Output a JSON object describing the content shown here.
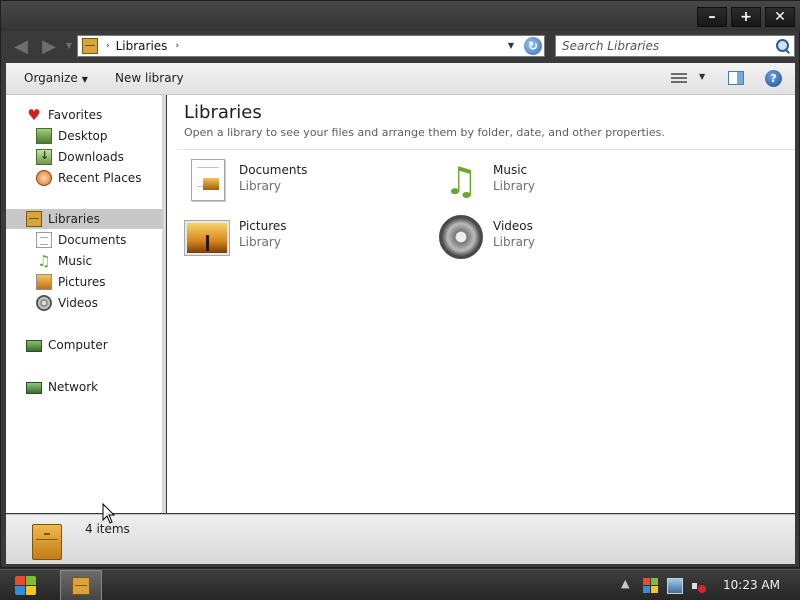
{
  "window": {
    "caption_buttons": {
      "minimize": "–",
      "maximize": "+",
      "close": "✕"
    }
  },
  "address_bar": {
    "separator": "›",
    "path": "Libraries",
    "trailing_separator": "›"
  },
  "search": {
    "placeholder": "Search Libraries"
  },
  "command_bar": {
    "organize": "Organize",
    "new_library": "New library"
  },
  "sidebar": {
    "favorites": [
      {
        "label": "Favorites",
        "icon": "heart-icon"
      },
      {
        "label": "Desktop",
        "icon": "desktop-icon"
      },
      {
        "label": "Downloads",
        "icon": "downloads-icon"
      },
      {
        "label": "Recent Places",
        "icon": "recent-places-icon"
      }
    ],
    "libraries": [
      {
        "label": "Libraries",
        "icon": "libraries-icon",
        "selected": true
      },
      {
        "label": "Documents",
        "icon": "documents-icon"
      },
      {
        "label": "Music",
        "icon": "music-icon"
      },
      {
        "label": "Pictures",
        "icon": "pictures-icon"
      },
      {
        "label": "Videos",
        "icon": "videos-icon"
      }
    ],
    "computer": {
      "label": "Computer",
      "icon": "computer-icon"
    },
    "network": {
      "label": "Network",
      "icon": "network-icon"
    }
  },
  "main": {
    "title": "Libraries",
    "subtitle": "Open a library to see your files and arrange them by folder, date, and other properties.",
    "libraries": [
      {
        "name": "Documents",
        "type": "Library",
        "icon": "documents-library-icon"
      },
      {
        "name": "Music",
        "type": "Library",
        "icon": "music-library-icon"
      },
      {
        "name": "Pictures",
        "type": "Library",
        "icon": "pictures-library-icon"
      },
      {
        "name": "Videos",
        "type": "Library",
        "icon": "videos-library-icon"
      }
    ]
  },
  "details": {
    "count": "4 items"
  },
  "taskbar": {
    "clock": "10:23 AM"
  },
  "colors": {
    "selection": "#c8c8c8",
    "frame": "#3a3a3a",
    "library_accent": "#d9a53b"
  }
}
